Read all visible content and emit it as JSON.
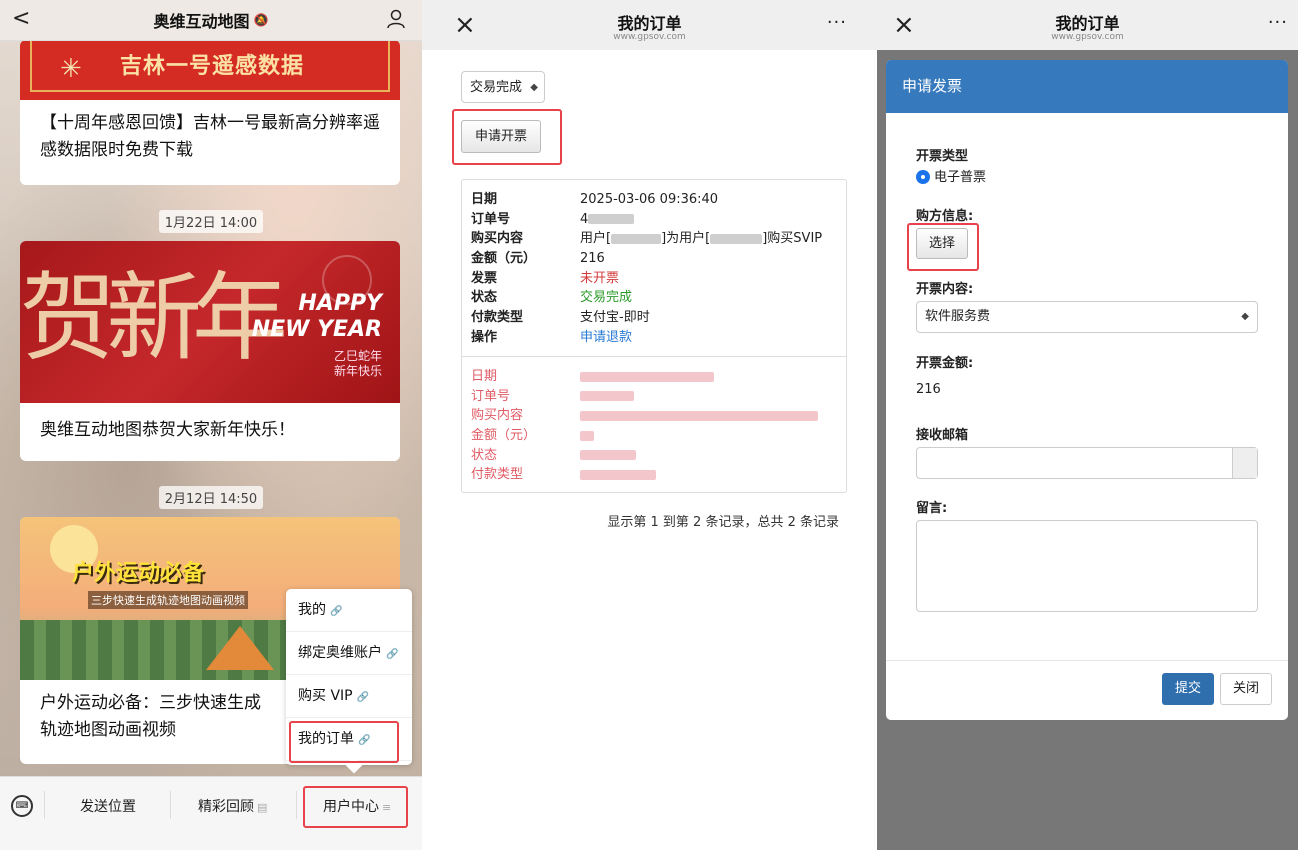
{
  "left": {
    "nav": {
      "back": "<",
      "title": "奥维互动地图",
      "mute_icon": "🔕"
    },
    "cards": [
      {
        "banner": "吉林一号遥感数据",
        "title": "【十周年感恩回馈】吉林一号最新高分辨率遥感数据限时免费下载"
      },
      {
        "banner_big": "贺新年",
        "banner_happy": "HAPPY",
        "banner_ny": "NEW YEAR",
        "banner_sub1": "乙巳蛇年",
        "banner_sub2": "新年快乐",
        "title": "奥维互动地图恭贺大家新年快乐！"
      },
      {
        "banner": "户外运动必备",
        "banner_sub": "三步快速生成轨迹地图动画视频",
        "title": "户外运动必备：三步快速生成轨迹地图动画视频"
      }
    ],
    "timestamps": [
      "1月22日 14:00",
      "2月12日 14:50"
    ],
    "popup_menu": [
      "我的",
      "绑定奥维账户",
      "购买 VIP",
      "我的订单"
    ],
    "bottom_bar": {
      "send_location": "发送位置",
      "highlights": "精彩回顾",
      "user_center": "用户中心"
    }
  },
  "middle": {
    "nav": {
      "close": "×",
      "title": "我的订单",
      "url": "www.gpsov.com",
      "more": "···"
    },
    "filter_selected": "交易完成",
    "apply_invoice_button": "申请开票",
    "order_labels": [
      "日期",
      "订单号",
      "购买内容",
      "金额（元）",
      "发票",
      "状态",
      "付款类型",
      "操作"
    ],
    "order1": {
      "date": "2025-03-06 09:36:40",
      "order_no_prefix": "4",
      "content_a": "用户[",
      "content_b": "]为用户[",
      "content_c": "]购买SVIP",
      "amount": "216",
      "invoice": "未开票",
      "status": "交易完成",
      "pay_type": "支付宝-即时",
      "action": "申请退款"
    },
    "order2_labels": [
      "日期",
      "订单号",
      "购买内容",
      "金额（元）",
      "状态",
      "付款类型"
    ],
    "paging": "显示第 1 到第 2 条记录，总共 2 条记录"
  },
  "right": {
    "nav": {
      "close": "×",
      "title": "我的订单",
      "url": "www.gpsov.com",
      "more": "···"
    },
    "modal_title": "申请发票",
    "invoice_type_label": "开票类型",
    "invoice_type_value": "电子普票",
    "buyer_label": "购方信息:",
    "choose_button": "选择",
    "content_label": "开票内容:",
    "content_value": "软件服务费",
    "amount_label": "开票金额:",
    "amount_value": "216",
    "email_label": "接收邮箱",
    "message_label": "留言:",
    "submit_button": "提交",
    "close_button": "关闭"
  },
  "colors": {
    "modal_header": "#3779bd",
    "highlight_box": "#e8434a",
    "status_green": "#2b9b2b",
    "invoice_red": "#d23c3c",
    "link_blue": "#2a7ad3"
  }
}
